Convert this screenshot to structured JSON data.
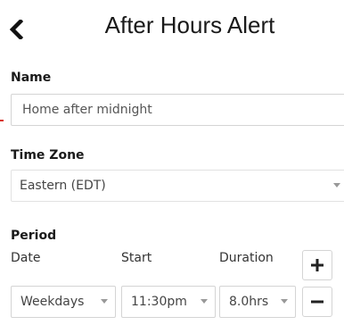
{
  "header": {
    "title": "After Hours Alert",
    "back_icon": "chevron-left-icon"
  },
  "name_section": {
    "label": "Name",
    "value": "Home after midnight"
  },
  "timezone_section": {
    "label": "Time Zone",
    "value": "Eastern (EDT)"
  },
  "period_section": {
    "label": "Period",
    "columns": {
      "date": "Date",
      "start": "Start",
      "duration": "Duration"
    },
    "row": {
      "date": "Weekdays",
      "start": "11:30pm",
      "duration": "8.0hrs"
    },
    "add_icon": "plus-icon",
    "remove_icon": "minus-icon"
  },
  "colors": {
    "accent_red": "#d9342b",
    "border": "#d4d4d4",
    "text": "#222222"
  }
}
